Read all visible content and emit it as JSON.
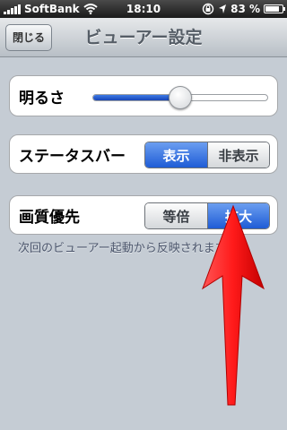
{
  "status_bar": {
    "carrier": "SoftBank",
    "time": "18:10",
    "battery": "83 %",
    "battery_level": 0.83,
    "icons": [
      "signal-icon",
      "wifi-icon",
      "lock-rotation-icon",
      "location-icon",
      "battery-icon"
    ]
  },
  "nav": {
    "title": "ビューアー設定",
    "close_label": "閉じる"
  },
  "brightness": {
    "label": "明るさ",
    "value": 0.5
  },
  "statusbar_setting": {
    "label": "ステータスバー",
    "options": [
      "表示",
      "非表示"
    ],
    "selected": "表示"
  },
  "image_quality": {
    "label": "画質優先",
    "options": [
      "等倍",
      "拡大"
    ],
    "selected": "拡大",
    "hint": "次回のビューアー起動から反映されます。"
  },
  "colors": {
    "accent": "#1f5cd6",
    "background": "#c5ccd4",
    "arrow": "#ff1a1a"
  }
}
